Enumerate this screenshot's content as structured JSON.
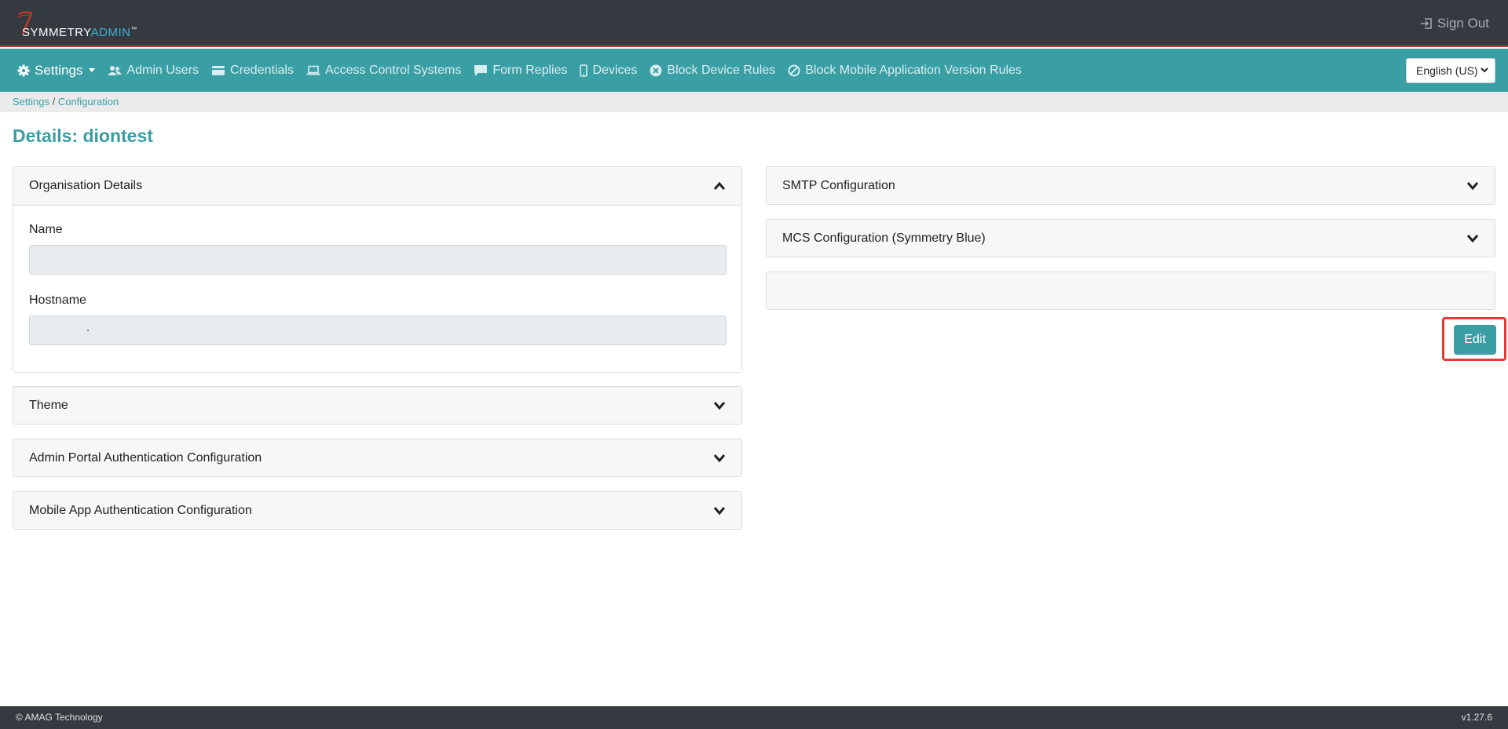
{
  "header": {
    "logo_primary": "SYMMETRY",
    "logo_secondary": "ADMIN",
    "logo_tm": "™",
    "signout_label": "Sign Out",
    "colors": {
      "bar": "#343a40",
      "accent_line": "#c0392b",
      "logo_admin": "#3fb0d9"
    }
  },
  "nav": {
    "items": [
      {
        "label": "Settings",
        "icon": "gear-icon"
      },
      {
        "label": "Admin Users",
        "icon": "users-icon"
      },
      {
        "label": "Credentials",
        "icon": "card-icon"
      },
      {
        "label": "Access Control Systems",
        "icon": "laptop-icon"
      },
      {
        "label": "Form Replies",
        "icon": "comment-icon"
      },
      {
        "label": "Devices",
        "icon": "mobile-icon"
      },
      {
        "label": "Block Device Rules",
        "icon": "times-circle-icon"
      },
      {
        "label": "Block Mobile Application Version Rules",
        "icon": "ban-icon"
      }
    ],
    "language": "English (US)",
    "color": "#3a9ea5"
  },
  "breadcrumb": {
    "root": "Settings",
    "separator": " / ",
    "current": "Configuration"
  },
  "page": {
    "title": "Details: diontest"
  },
  "left_panels": {
    "organisation": {
      "title": "Organisation Details",
      "name_label": "Name",
      "name_value": "",
      "hostname_label": "Hostname",
      "hostname_value": "."
    },
    "theme": {
      "title": "Theme"
    },
    "admin_auth": {
      "title": "Admin Portal Authentication Configuration"
    },
    "mobile_auth": {
      "title": "Mobile App Authentication Configuration"
    }
  },
  "right_panels": {
    "smtp": {
      "title": "SMTP Configuration"
    },
    "mcs": {
      "title": "MCS Configuration (Symmetry Blue)"
    },
    "blank": {
      "title": ""
    }
  },
  "actions": {
    "edit_label": "Edit"
  },
  "footer": {
    "copyright": "© AMAG Technology",
    "version": "v1.27.6"
  }
}
